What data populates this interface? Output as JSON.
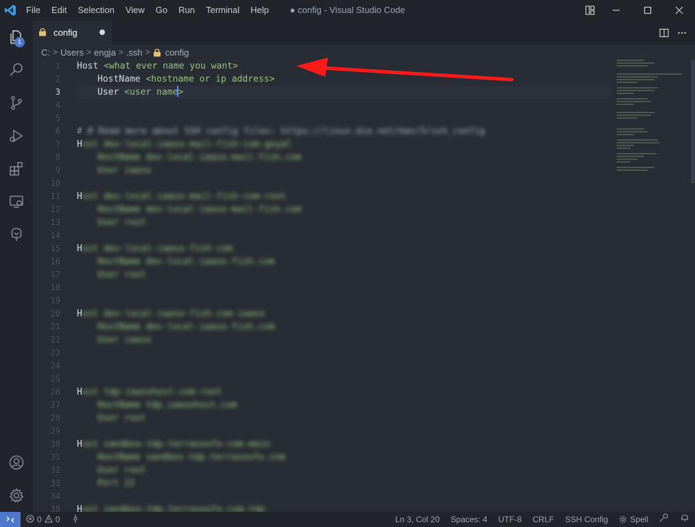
{
  "window": {
    "title": "● config - Visual Studio Code"
  },
  "menu": [
    "File",
    "Edit",
    "Selection",
    "View",
    "Go",
    "Run",
    "Terminal",
    "Help"
  ],
  "activity": {
    "explorer_badge": "1"
  },
  "tab": {
    "label": "config"
  },
  "breadcrumb": {
    "parts": [
      "C:",
      "Users",
      "engja",
      ".ssh"
    ],
    "file": "config"
  },
  "editor": {
    "line_numbers": [
      "1",
      "2",
      "3",
      "4",
      "5",
      "6",
      "7",
      "8",
      "9",
      "10",
      "11",
      "12",
      "13",
      "14",
      "15",
      "16",
      "17",
      "18",
      "19",
      "20",
      "21",
      "22",
      "23",
      "24",
      "25",
      "26",
      "27",
      "28",
      "29",
      "30",
      "31",
      "32",
      "33",
      "34",
      "35"
    ],
    "line1_keyword": "Host",
    "line1_value": "<what ever name you want>",
    "line2_keyword": "HostName",
    "line2_value": "<hostname or ip address>",
    "line3_keyword": "User",
    "line3_value_before_cursor": "<user name",
    "line3_value_after_cursor": ">",
    "blurred_comment": "# Read more about SSH config files: https://linux.die.net/man/5/ssh_config",
    "blurred_h": "H",
    "blurred": {
      "l7": "ost dev-local-iaaso-mail-fish-com-goyal",
      "l8": "HostName dev-local-iaaso-mail-fish.com",
      "l9": "User iaaso",
      "l11": "ost dev-local-iaaso-mail-fish-com-root",
      "l12": "HostName dev-local-iaaso-mail-fish.com",
      "l13": "User root",
      "l15": "ost dev-local-iaaso-fish-com",
      "l16": "HostName dev-local-iaaso-fish.com",
      "l17": "User root",
      "l20": "ost dev-local-iaaso-fish-com-iaaso",
      "l21": "HostName dev-local-iaaso-fish.com",
      "l22": "User iaaso",
      "l26": "ost tdp-iaasohost-com-root",
      "l27": "HostName tdp.iaasohost.com",
      "l28": "User root",
      "l30": "ost sandbox-tdp-terrasoufo-com-main",
      "l31": "HostName sandbox-tdp.terrasoufo.com",
      "l32": "User root",
      "l33": "Port 22",
      "l35": "ost sandbox-tdp-terrasoufo-com-tdp"
    }
  },
  "status": {
    "errors": "0",
    "warnings": "0",
    "position": "Ln 3, Col 20",
    "spaces": "Spaces: 4",
    "encoding": "UTF-8",
    "eol": "CRLF",
    "language": "SSH Config",
    "spell": "Spell"
  },
  "colors": {
    "accent": "#4d78cc",
    "string": "#98c379",
    "annotation_arrow": "#ff1a1a"
  }
}
